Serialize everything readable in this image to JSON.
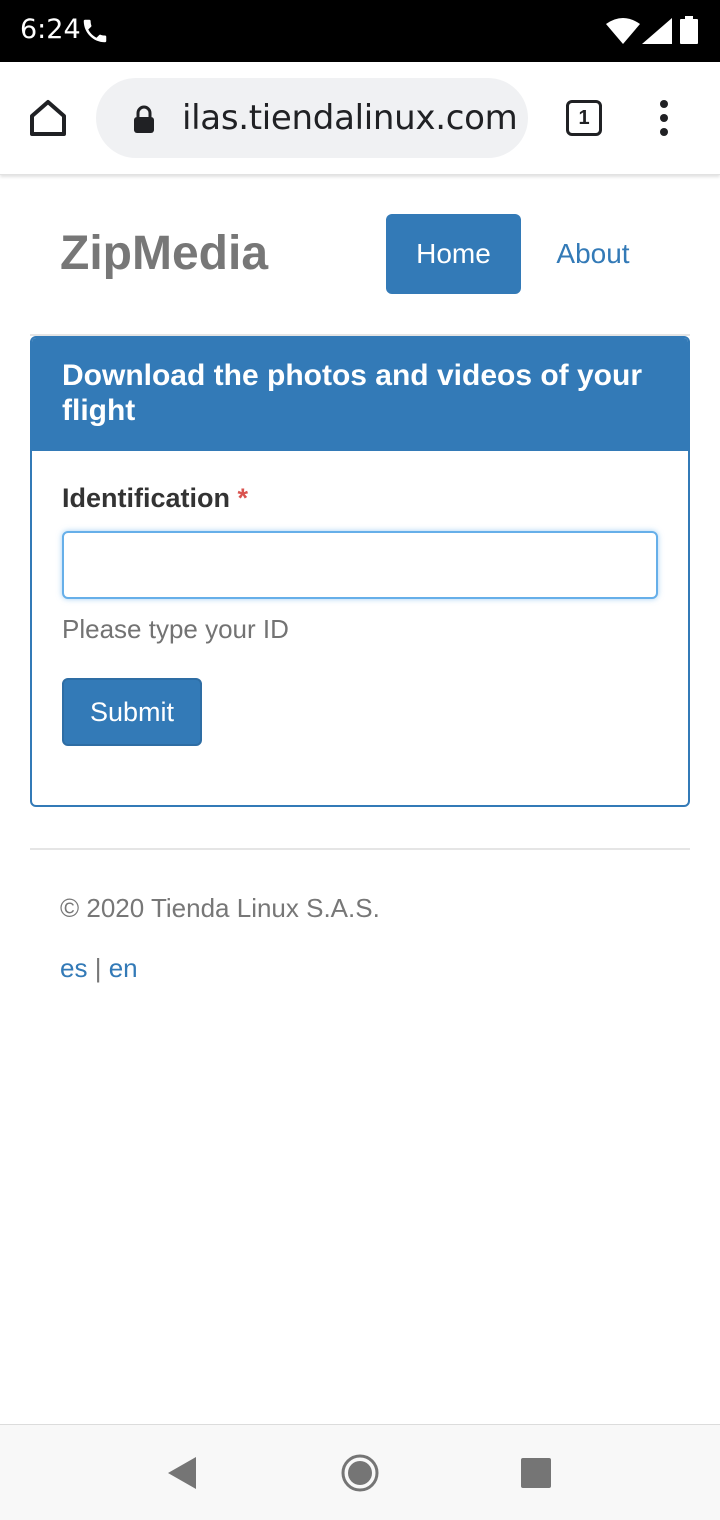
{
  "status_bar": {
    "time": "6:24",
    "icons": [
      "phone-icon",
      "wifi-icon",
      "signal-icon",
      "battery-icon"
    ]
  },
  "browser": {
    "url": "ilas.tiendalinux.com",
    "tab_count": "1",
    "icons": [
      "home-icon",
      "lock-icon",
      "tabs-icon",
      "more-vert-icon"
    ]
  },
  "navbar": {
    "brand": "ZipMedia",
    "items": [
      {
        "label": "Home",
        "active": true
      },
      {
        "label": "About",
        "active": false
      }
    ]
  },
  "panel": {
    "heading": "Download the photos and videos of your flight",
    "field_label": "Identification",
    "required_marker": "*",
    "input_value": "",
    "help_text": "Please type your ID",
    "submit_label": "Submit"
  },
  "footer": {
    "copyright": "© 2020 Tienda Linux S.A.S.",
    "languages": [
      "es",
      "en"
    ],
    "separator": "|"
  },
  "colors": {
    "primary": "#337ab7",
    "brand_text": "#777777",
    "required": "#d9534f"
  }
}
